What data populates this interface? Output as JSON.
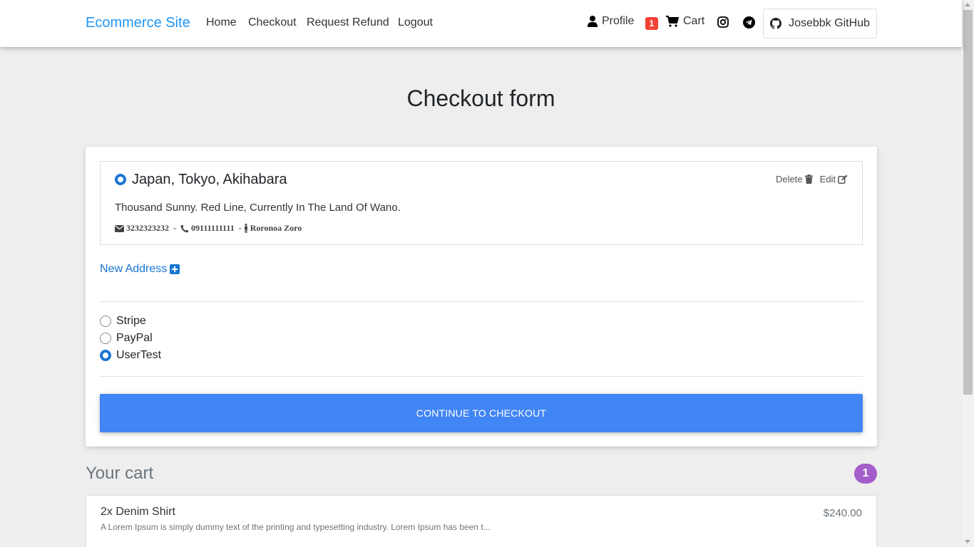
{
  "nav": {
    "brand": "Ecommerce Site",
    "links": [
      "Home",
      "Checkout",
      "Request Refund",
      "Logout"
    ],
    "profile_label": "Profile",
    "cart_count": "1",
    "cart_label": "Cart",
    "github_label": "Josebbk GitHub",
    "icons": [
      "user-icon",
      "cart-icon",
      "instagram-icon",
      "telegram-icon",
      "github-icon"
    ]
  },
  "page": {
    "title": "Checkout form"
  },
  "address": {
    "title": "Japan, Tokyo, Akihabara",
    "line": "Thousand Sunny. Red Line, Currently In The Land Of Wano.",
    "postal": "3232323232",
    "phone": "09111111111",
    "name": "Roronoa Zoro",
    "delete_label": "Delete",
    "edit_label": "Edit",
    "selected": true
  },
  "new_address_label": "New Address",
  "payment": {
    "options": [
      {
        "label": "Stripe",
        "selected": false
      },
      {
        "label": "PayPal",
        "selected": false
      },
      {
        "label": "UserTest",
        "selected": true
      }
    ]
  },
  "continue_label": "CONTINUE TO CHECKOUT",
  "cart": {
    "heading": "Your cart",
    "count": "1",
    "items": [
      {
        "name": "2x Denim Shirt",
        "price": "$240.00",
        "description": "A Lorem Ipsum is simply dummy text of the printing and typesetting industry. Lorem Ipsum has been t..."
      }
    ]
  },
  "colors": {
    "brand": "#2196f3",
    "primary_button": "#4285f4",
    "radio_selected": "#1976d2",
    "cart_badge": "#a35ec9",
    "nav_badge": "#f44336"
  }
}
